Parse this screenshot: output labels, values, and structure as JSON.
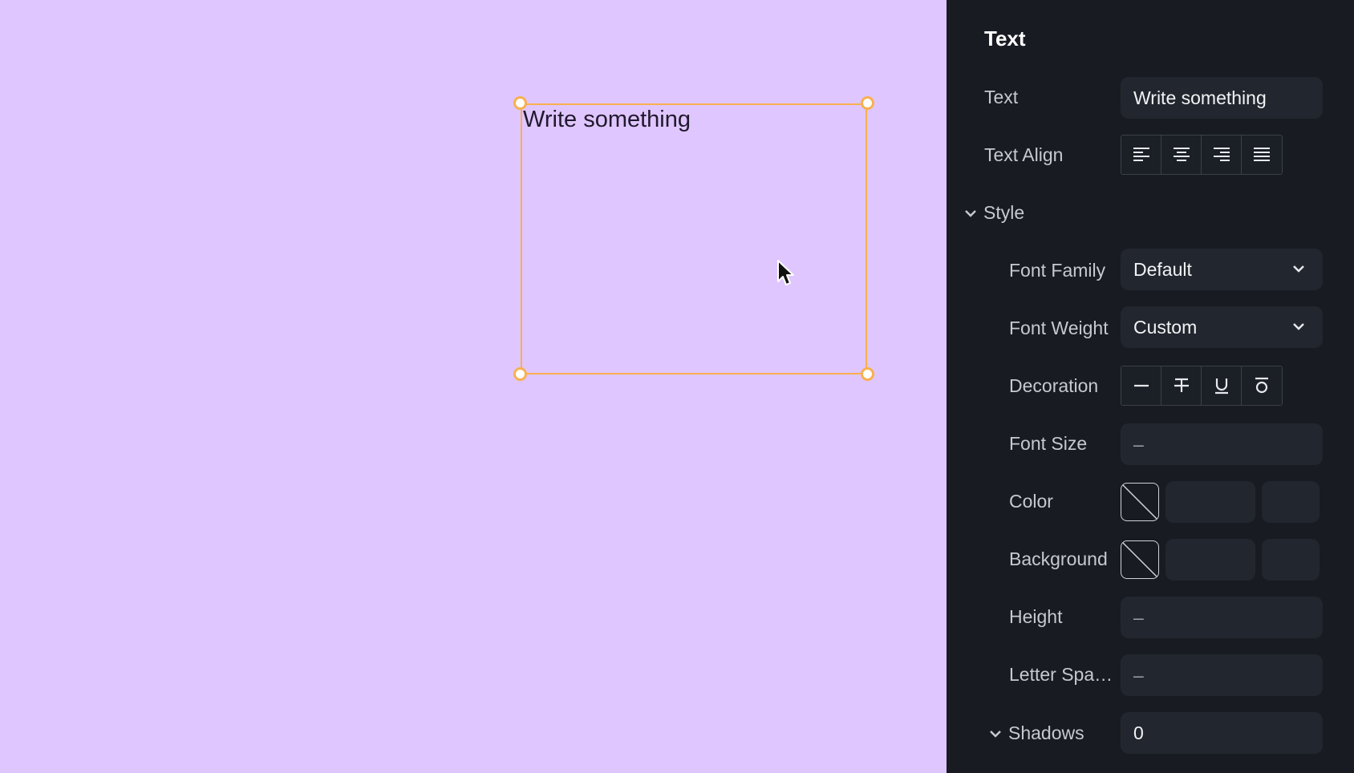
{
  "canvas": {
    "background": "#e0c6fe",
    "selection_color": "#f8b04e",
    "textbox": {
      "content": "Write something"
    }
  },
  "panel": {
    "title": "Text",
    "text": {
      "label": "Text",
      "value": "Write something"
    },
    "text_align": {
      "label": "Text Align",
      "options": [
        "align-left-icon",
        "align-center-icon",
        "align-right-icon",
        "align-justify-icon"
      ]
    },
    "style": {
      "label": "Style",
      "font_family": {
        "label": "Font Family",
        "value": "Default"
      },
      "font_weight": {
        "label": "Font Weight",
        "value": "Custom"
      },
      "decoration": {
        "label": "Decoration",
        "options": [
          "decoration-none-icon",
          "strikethrough-icon",
          "underline-icon",
          "overline-icon"
        ]
      },
      "font_size": {
        "label": "Font Size",
        "value": "–"
      },
      "color": {
        "label": "Color",
        "hex": "",
        "alpha": ""
      },
      "background": {
        "label": "Background",
        "hex": "",
        "alpha": ""
      },
      "height": {
        "label": "Height",
        "value": "–"
      },
      "letter_spacing": {
        "label": "Letter Spa…",
        "value": "–"
      }
    },
    "shadows": {
      "label": "Shadows",
      "value": "0"
    }
  }
}
